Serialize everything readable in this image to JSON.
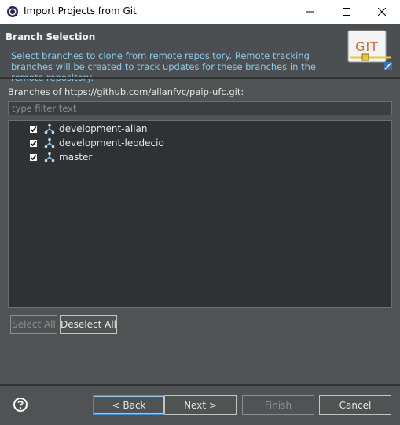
{
  "window": {
    "title": "Import Projects from Git"
  },
  "header": {
    "title": "Branch Selection",
    "description": "Select branches to clone from remote repository. Remote tracking branches will be created to track updates for these branches in the remote repository.",
    "logo_text": "GIT"
  },
  "branches": {
    "label": "Branches of https://github.com/allanfvc/paip-ufc.git:",
    "filter_placeholder": "type filter text",
    "items": [
      {
        "label": "development-allan",
        "checked": true
      },
      {
        "label": "development-leodecio",
        "checked": true
      },
      {
        "label": "master",
        "checked": true
      }
    ],
    "select_all_label": "Select All",
    "deselect_all_label": "Deselect All"
  },
  "footer": {
    "back_label": "< Back",
    "next_label": "Next >",
    "finish_label": "Finish",
    "cancel_label": "Cancel"
  },
  "colors": {
    "background": "#505354",
    "header_desc": "#8fc8e8",
    "tree_bg": "#2f3234",
    "default_button_border": "#3c8fd6"
  },
  "icons": [
    "eclipse-app-icon",
    "minimize-icon",
    "maximize-icon",
    "close-icon",
    "git-logo-icon",
    "branch-icon",
    "checkbox-checked-icon",
    "help-icon"
  ]
}
